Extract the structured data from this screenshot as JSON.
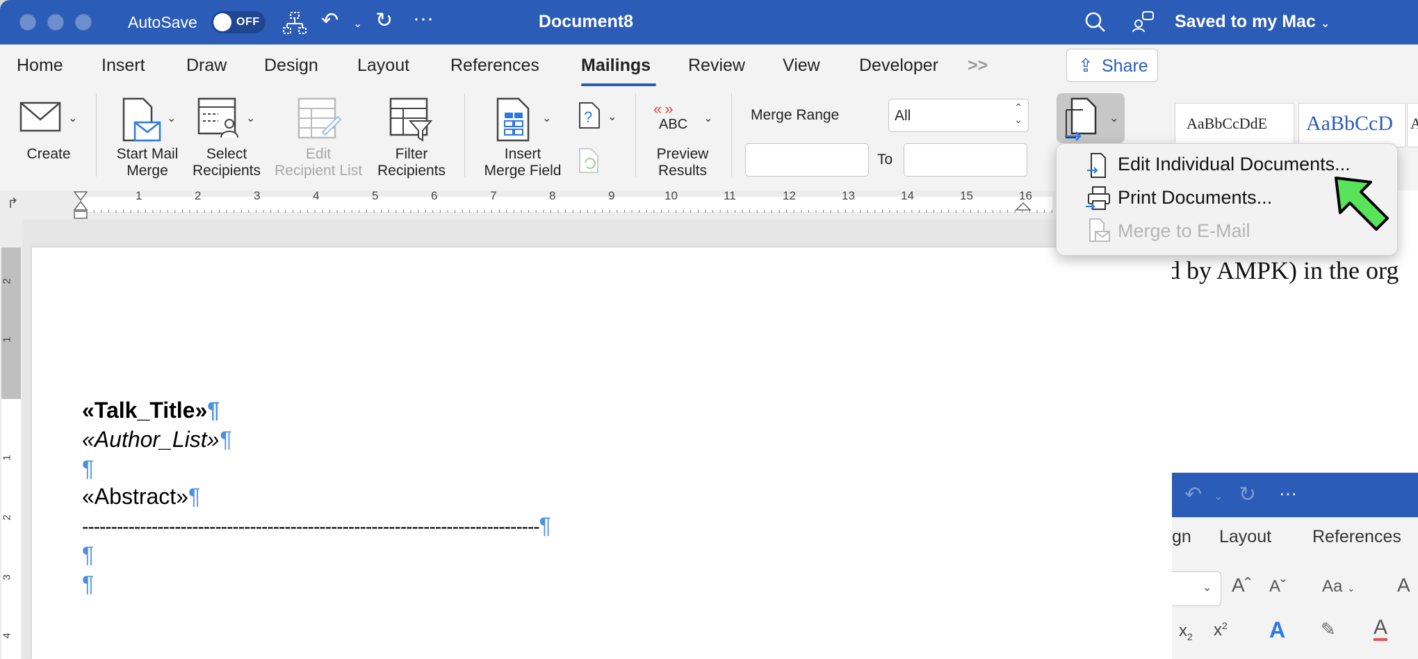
{
  "titlebar": {
    "autosave_label": "AutoSave",
    "toggle_state": "OFF",
    "doc_title": "Document8",
    "more": "···"
  },
  "tabs": [
    {
      "label": "Home"
    },
    {
      "label": "Insert"
    },
    {
      "label": "Draw"
    },
    {
      "label": "Design"
    },
    {
      "label": "Layout"
    },
    {
      "label": "References"
    },
    {
      "label": "Mailings"
    },
    {
      "label": "Review"
    },
    {
      "label": "View"
    },
    {
      "label": "Developer"
    }
  ],
  "tabs_overflow": ">>",
  "share_label": "Share",
  "ribbon": {
    "create": "Create",
    "start_mail_merge": [
      "Start Mail",
      "Merge"
    ],
    "select_recipients": [
      "Select",
      "Recipients"
    ],
    "edit_recipient_list": [
      "Edit",
      "Recipient List"
    ],
    "filter_recipients": [
      "Filter",
      "Recipients"
    ],
    "insert_merge_field": [
      "Insert",
      "Merge Field"
    ],
    "preview_abc": "ABC",
    "preview_results": [
      "Preview",
      "Results"
    ],
    "merge_range_label": "Merge Range",
    "merge_range_value": "All",
    "to_label": "To"
  },
  "ruler": [
    "1",
    "2",
    "3",
    "4",
    "5",
    "6",
    "7",
    "8",
    "9",
    "10",
    "11",
    "12",
    "13",
    "14",
    "15",
    "16"
  ],
  "vruler": [
    "2",
    "1",
    "1",
    "2",
    "3",
    "4"
  ],
  "document": {
    "talk_title": "«Talk_Title»",
    "author_list": "«Author_List»",
    "abstract": "«Abstract»",
    "separator": "-------------------------------------------------------------------------------",
    "pilcrow": "¶"
  },
  "menu": {
    "items": [
      {
        "label": "Edit Individual Documents...",
        "enabled": true
      },
      {
        "label": "Print Documents...",
        "enabled": true
      },
      {
        "label": "Merge to E-Mail",
        "enabled": false
      }
    ]
  },
  "background_window": {
    "saved_status": "Saved to my Mac",
    "style1": "AaBbCcDdE",
    "style2": "AaBbCcD",
    "style3": "A",
    "body_text": "d by AMPK) in the org",
    "tabs": [
      "gn",
      "Layout",
      "References"
    ],
    "aa_label": "Aa"
  },
  "colors": {
    "title_blue": "#2b5cb8",
    "pilcrow_blue": "#4a90e2",
    "arrow_green": "#58e35b"
  }
}
